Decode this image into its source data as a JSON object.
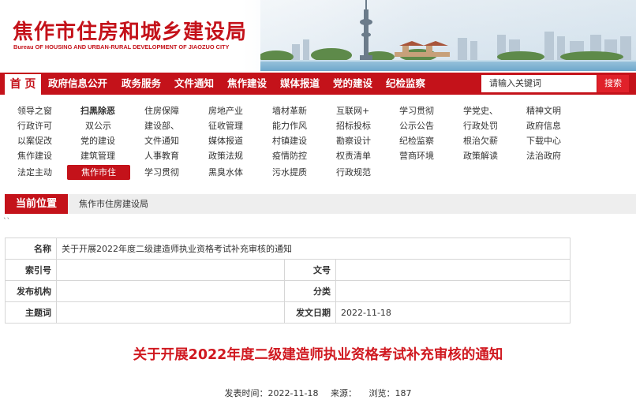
{
  "site": {
    "title": "焦作市住房和城乡建设局",
    "subtitle": "Bureau OF HOUSING AND URBAN-RURAL DEVELOPMENT OF JIAOZUO CITY"
  },
  "nav": {
    "home": "首 页",
    "items": [
      "政府信息公开",
      "政务服务",
      "文件通知",
      "焦作建设",
      "媒体报道",
      "党的建设",
      "纪检监察"
    ],
    "search_placeholder": "请输入关键词",
    "search_button": "搜索"
  },
  "links": [
    [
      "领导之窗",
      "扫黑除恶",
      "住房保障",
      "房地产业",
      "墙材革新",
      "互联网+",
      "学习贯彻",
      "学党史、",
      "精神文明"
    ],
    [
      "行政许可",
      "双公示",
      "建设部、",
      "征收管理",
      "能力作风",
      "招标投标",
      "公示公告",
      "行政处罚",
      "政府信息"
    ],
    [
      "以案促改",
      "党的建设",
      "文件通知",
      "媒体报道",
      "村镇建设",
      "勘察设计",
      "纪检监察",
      "根治欠薪",
      "下载中心"
    ],
    [
      "焦作建设",
      "建筑管理",
      "人事教育",
      "政策法规",
      "疫情防控",
      "权责清单",
      "营商环境",
      "政策解读",
      "法治政府"
    ],
    [
      "法定主动",
      "焦作市住",
      "学习贯彻",
      "黑臭水体",
      "污水提质",
      "行政规范"
    ]
  ],
  "breadcrumb": {
    "label": "当前位置",
    "path": "焦作市住房建设局"
  },
  "info": {
    "name_label": "名称",
    "name_value": "关于开展2022年度二级建造师执业资格考试补充审核的通知",
    "index_label": "索引号",
    "index_value": "",
    "docno_label": "文号",
    "docno_value": "",
    "issuer_label": "发布机构",
    "issuer_value": "",
    "category_label": "分类",
    "category_value": "",
    "topic_label": "主题词",
    "topic_value": "",
    "date_label": "发文日期",
    "date_value": "2022-11-18"
  },
  "article": {
    "title": "关于开展2022年度二级建造师执业资格考试补充审核的通知",
    "publish_label": "发表时间：",
    "publish_value": "2022-11-18",
    "source_label": "来源：",
    "source_value": "",
    "views_label": "浏览：",
    "views_value": "187"
  },
  "colors": {
    "accent": "#c4121a",
    "title_red": "#d01920"
  }
}
